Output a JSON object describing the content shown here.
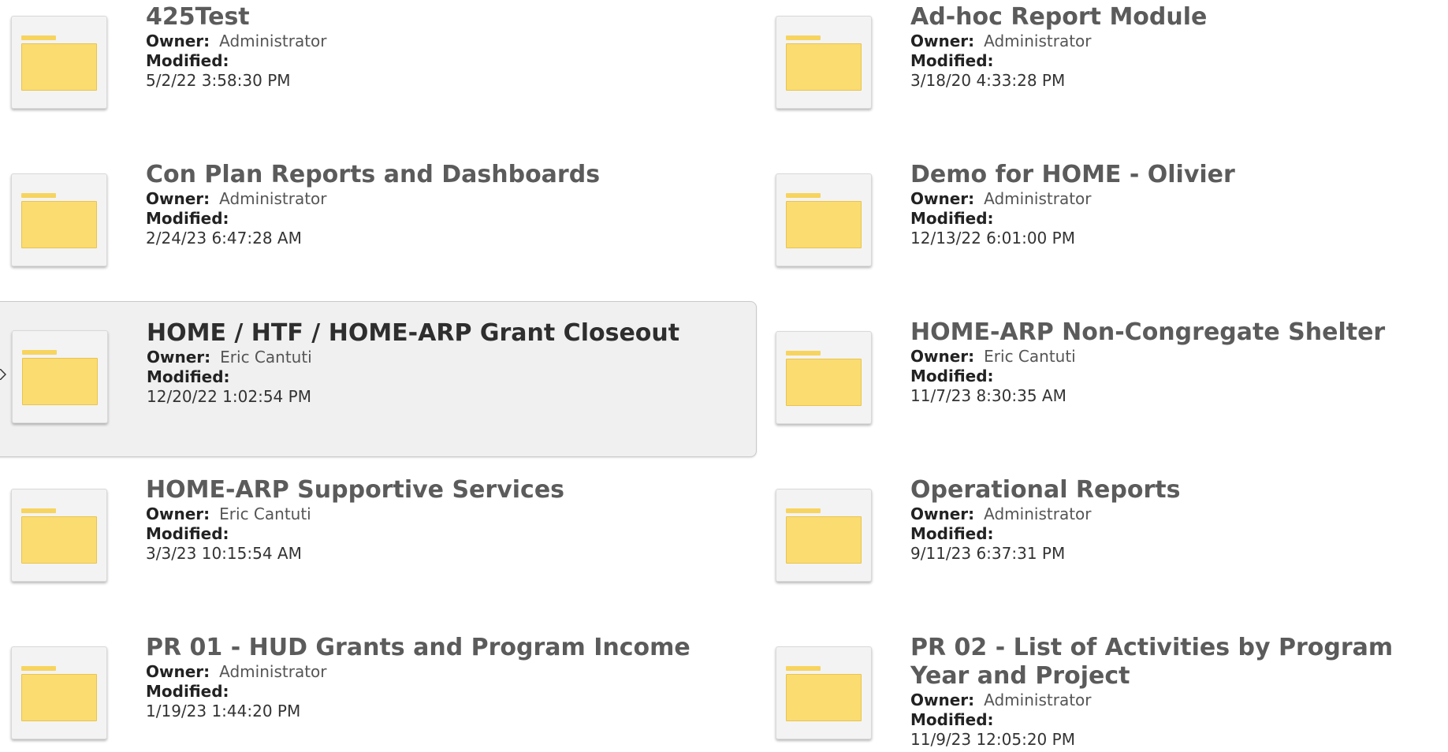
{
  "labels": {
    "owner": "Owner:",
    "modified": "Modified:"
  },
  "folders": [
    {
      "title": "425Test",
      "owner": "Administrator",
      "modified": "5/2/22 3:58:30 PM"
    },
    {
      "title": "Ad-hoc Report Module",
      "owner": "Administrator",
      "modified": "3/18/20 4:33:28 PM"
    },
    {
      "title": "Con Plan Reports and Dashboards",
      "owner": "Administrator",
      "modified": "2/24/23 6:47:28 AM"
    },
    {
      "title": "Demo for HOME - Olivier",
      "owner": "Administrator",
      "modified": "12/13/22 6:01:00 PM"
    },
    {
      "title": "HOME / HTF / HOME-ARP Grant Closeout",
      "owner": "Eric Cantuti",
      "modified": "12/20/22 1:02:54 PM",
      "selected": true
    },
    {
      "title": "HOME-ARP Non-Congregate Shelter",
      "owner": "Eric Cantuti",
      "modified": "11/7/23 8:30:35 AM"
    },
    {
      "title": "HOME-ARP Supportive Services",
      "owner": "Eric Cantuti",
      "modified": "3/3/23 10:15:54 AM"
    },
    {
      "title": "Operational Reports",
      "owner": "Administrator",
      "modified": "9/11/23 6:37:31 PM"
    },
    {
      "title": "PR 01 - HUD Grants and Program Income",
      "owner": "Administrator",
      "modified": "1/19/23 1:44:20 PM"
    },
    {
      "title": "PR 02 - List of Activities by Program Year and Project",
      "owner": "Administrator",
      "modified": "11/9/23 12:05:20 PM"
    }
  ],
  "colors": {
    "folder": "#fbdc71",
    "selected_bg": "#f0f0f0",
    "title": "#5b5b5b"
  }
}
